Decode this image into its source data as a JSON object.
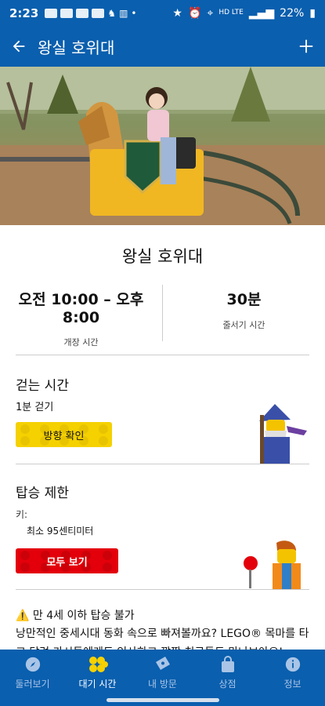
{
  "status": {
    "time": "2:23",
    "left_icons": [
      "talk-icon",
      "on-icon",
      "photo-icon",
      "gallery-icon",
      "bottle-icon",
      "building-icon",
      "dot-icon"
    ],
    "battery": "22%",
    "network": "HD LTE"
  },
  "header": {
    "title": "왕실 호위대"
  },
  "ride": {
    "title": "왕실 호위대",
    "hours": "오전 10:00 – 오후 8:00",
    "hours_label": "개장 시간",
    "wait": "30분",
    "wait_label": "줄서기 시간"
  },
  "walk": {
    "heading": "걷는 시간",
    "value": "1분 걷기",
    "button": "방향 확인"
  },
  "restriction": {
    "heading": "탑승 제한",
    "height_label": "키:",
    "height_value": "최소 95센티미터",
    "button": "모두 보기"
  },
  "notice": {
    "warning": "만 4세 이하 탑승 불가",
    "description": "낭만적인 중세시대 동화 속으로 빠져볼까요? LEGO® 목마를 타고 달려 가시들에게도 인사하고 깜짝 친구들도 만나보아요!"
  },
  "nav": {
    "items": [
      {
        "label": "둘러보기",
        "icon": "compass-icon"
      },
      {
        "label": "대기 시간",
        "icon": "lego-bricks-icon"
      },
      {
        "label": "내 방문",
        "icon": "ticket-icon"
      },
      {
        "label": "상점",
        "icon": "shopping-bag-icon"
      },
      {
        "label": "정보",
        "icon": "info-icon"
      }
    ],
    "active": "대기 시간"
  },
  "colors": {
    "primary": "#0a5fae",
    "yellow": "#f5d100",
    "red": "#e3000b"
  }
}
